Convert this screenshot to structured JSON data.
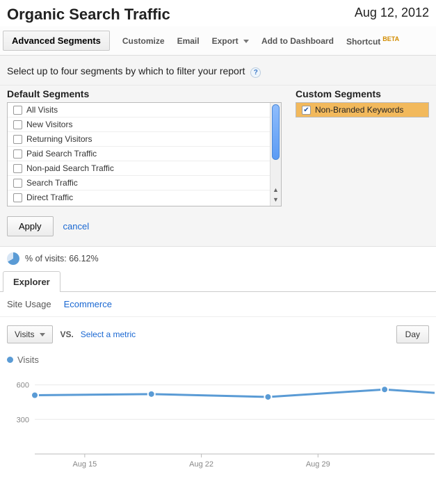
{
  "header": {
    "title": "Organic Search Traffic",
    "date": "Aug 12, 2012"
  },
  "toolbar": {
    "advanced_segments": "Advanced Segments",
    "customize": "Customize",
    "email": "Email",
    "export": "Export",
    "add_to_dashboard": "Add to Dashboard",
    "shortcut": "Shortcut",
    "shortcut_badge": "BETA"
  },
  "segments": {
    "instruction": "Select up to four segments by which to filter your report",
    "default_label": "Default Segments",
    "custom_label": "Custom Segments",
    "default_items": [
      "All Visits",
      "New Visitors",
      "Returning Visitors",
      "Paid Search Traffic",
      "Non-paid Search Traffic",
      "Search Traffic",
      "Direct Traffic"
    ],
    "custom_items": [
      {
        "label": "Non-Branded Keywords",
        "checked": true
      }
    ],
    "apply": "Apply",
    "cancel": "cancel"
  },
  "pct": {
    "label": "% of visits: 66.12%"
  },
  "explorer": {
    "tab": "Explorer",
    "sub_site_usage": "Site Usage",
    "sub_ecommerce": "Ecommerce"
  },
  "metric": {
    "primary": "Visits",
    "vs": "VS.",
    "select_metric": "Select a metric",
    "granularity": "Day"
  },
  "legend": {
    "series": "Visits"
  },
  "chart_data": {
    "type": "line",
    "ylabel": "",
    "xlabel": "",
    "ylim": [
      0,
      700
    ],
    "y_ticks": [
      300,
      600
    ],
    "x_ticks": [
      "Aug 15",
      "Aug 22",
      "Aug 29"
    ],
    "series": [
      {
        "name": "Visits",
        "color": "#5a9bd5",
        "points": [
          {
            "x": 0,
            "y": 510,
            "marker": true
          },
          {
            "x": 7,
            "y": 520,
            "marker": true
          },
          {
            "x": 14,
            "y": 495,
            "marker": true
          },
          {
            "x": 21,
            "y": 560,
            "marker": true
          },
          {
            "x": 24,
            "y": 530,
            "marker": false
          }
        ]
      }
    ],
    "x_range": [
      0,
      24
    ]
  }
}
